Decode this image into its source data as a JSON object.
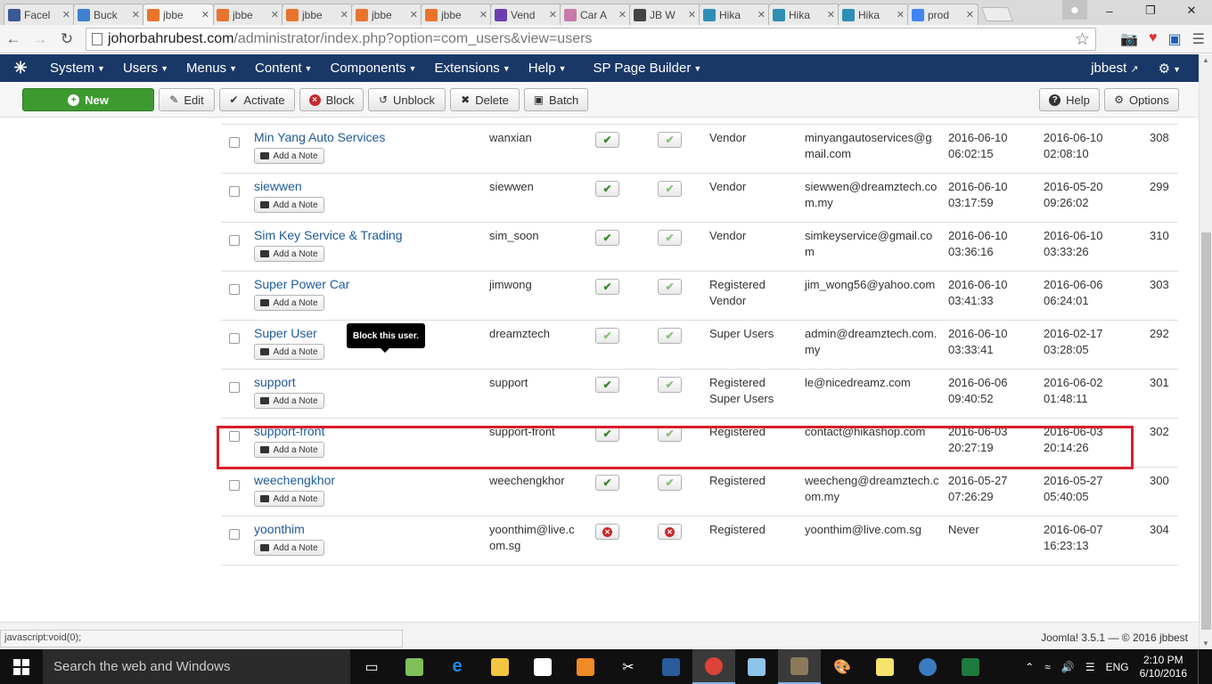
{
  "browser": {
    "tabs": [
      {
        "title": "Facel",
        "color": "#3b5998",
        "active": false
      },
      {
        "title": "Buck",
        "color": "#3e7fd0",
        "active": false
      },
      {
        "title": "jbbe",
        "color": "#e8742d",
        "active": true
      },
      {
        "title": "jbbe",
        "color": "#e8742d",
        "active": false
      },
      {
        "title": "jbbe",
        "color": "#e8742d",
        "active": false
      },
      {
        "title": "jbbe",
        "color": "#e8742d",
        "active": false
      },
      {
        "title": "jbbe",
        "color": "#e8742d",
        "active": false
      },
      {
        "title": "Vend",
        "color": "#6c3fb1",
        "active": false
      },
      {
        "title": "Car A",
        "color": "#c97aa8",
        "active": false
      },
      {
        "title": "JB W",
        "color": "#444444",
        "active": false
      },
      {
        "title": "Hika",
        "color": "#2d8fb5",
        "active": false
      },
      {
        "title": "Hika",
        "color": "#2d8fb5",
        "active": false
      },
      {
        "title": "Hika",
        "color": "#2d8fb5",
        "active": false
      },
      {
        "title": "prod",
        "color": "#4285f4",
        "active": false
      }
    ],
    "url_host": "johorbahrubest.com",
    "url_path": "/administrator/index.php?option=com_users&view=users",
    "status_text": "javascript:void(0);"
  },
  "joomla_nav": {
    "menus": [
      "System",
      "Users",
      "Menus",
      "Content",
      "Components",
      "Extensions",
      "Help",
      "SP Page Builder"
    ],
    "user": "jbbest"
  },
  "toolbar": {
    "new": "New",
    "edit": "Edit",
    "activate": "Activate",
    "block": "Block",
    "unblock": "Unblock",
    "delete": "Delete",
    "batch": "Batch",
    "help": "Help",
    "options": "Options"
  },
  "note_label": "Add a Note",
  "tooltip": "Block this user.",
  "users": [
    {
      "name": "Min Yang Auto Services",
      "login": "wanxian",
      "enabled": true,
      "activated": true,
      "groups": "Vendor",
      "email": "minyangautoservices@gmail.com",
      "last_visit": "2016-06-10 06:02:15",
      "registered": "2016-06-10 02:08:10",
      "id": "308"
    },
    {
      "name": "siewwen",
      "login": "siewwen",
      "enabled": true,
      "activated": true,
      "groups": "Vendor",
      "email": "siewwen@dreamztech.com.my",
      "last_visit": "2016-06-10 03:17:59",
      "registered": "2016-05-20 09:26:02",
      "id": "299"
    },
    {
      "name": "Sim Key Service & Trading",
      "login": "sim_soon",
      "enabled": true,
      "activated": true,
      "groups": "Vendor",
      "email": "simkeyservice@gmail.com",
      "last_visit": "2016-06-10 03:36:16",
      "registered": "2016-06-10 03:33:26",
      "id": "310"
    },
    {
      "name": "Super Power Car",
      "login": "jimwong",
      "enabled": true,
      "activated": true,
      "groups": "Registered Vendor",
      "email": "jim_wong56@yahoo.com",
      "last_visit": "2016-06-10 03:41:33",
      "registered": "2016-06-06 06:24:01",
      "id": "303"
    },
    {
      "name": "Super User",
      "login": "dreamztech",
      "enabled": true,
      "activated": true,
      "groups": "Super Users",
      "email": "admin@dreamztech.com.my",
      "last_visit": "2016-06-10 03:33:41",
      "registered": "2016-02-17 03:28:05",
      "id": "292"
    },
    {
      "name": "support",
      "login": "support",
      "enabled": true,
      "activated": true,
      "groups": "Registered Super Users",
      "email": "le@nicedreamz.com",
      "last_visit": "2016-06-06 09:40:52",
      "registered": "2016-06-02 01:48:11",
      "id": "301"
    },
    {
      "name": "support-front",
      "login": "support-front",
      "enabled": true,
      "activated": true,
      "groups": "Registered",
      "email": "contact@hikashop.com",
      "last_visit": "2016-06-03 20:27:19",
      "registered": "2016-06-03 20:14:26",
      "id": "302"
    },
    {
      "name": "weechengkhor",
      "login": "weechengkhor",
      "enabled": true,
      "activated": true,
      "groups": "Registered",
      "email": "weecheng@dreamztech.com.my",
      "last_visit": "2016-05-27 07:26:29",
      "registered": "2016-05-27 05:40:05",
      "id": "300"
    },
    {
      "name": "yoonthim",
      "login": "yoonthim@live.com.sg",
      "enabled": false,
      "activated": false,
      "groups": "Registered",
      "email": "yoonthim@live.com.sg",
      "last_visit": "Never",
      "registered": "2016-06-07 16:23:13",
      "id": "304"
    }
  ],
  "footer": "Joomla! 3.5.1 — © 2016 jbbest",
  "taskbar": {
    "search_placeholder": "Search the web and Windows",
    "lang": "ENG",
    "time": "2:10 PM",
    "date": "6/10/2016"
  }
}
